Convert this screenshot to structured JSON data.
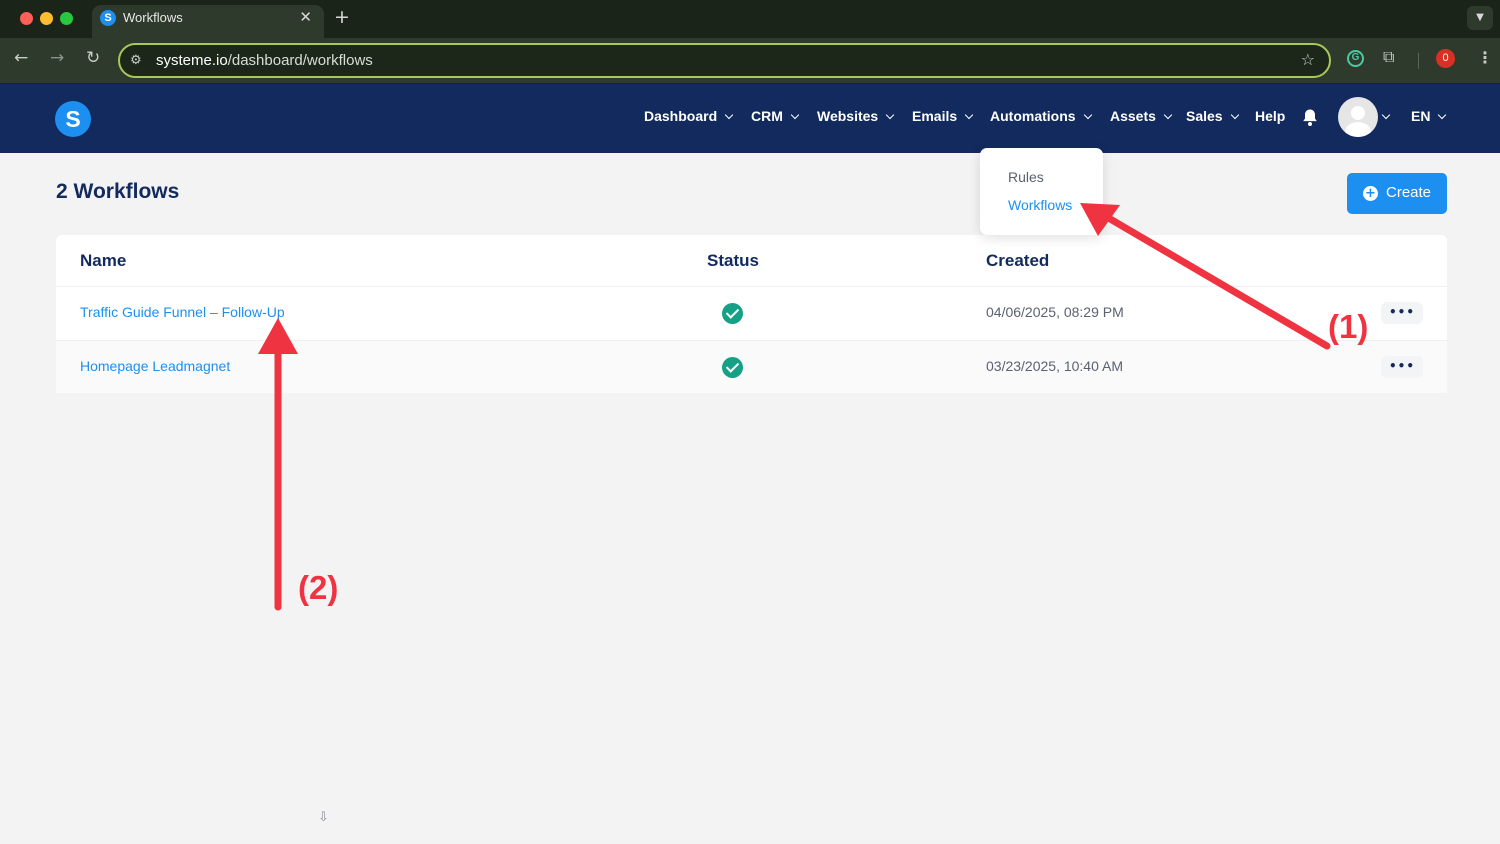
{
  "browser": {
    "tab_title": "Workflows",
    "tab_favicon": "S",
    "close_glyph": "✕",
    "new_tab_glyph": "+",
    "url_host": "systeme.io",
    "url_path": "/dashboard/workflows",
    "extension_badge": "0",
    "extension_g": "G",
    "icons": [
      "back-icon",
      "forward-icon",
      "reload-icon",
      "site-settings-icon",
      "bookmark-star-icon",
      "grammarly-icon",
      "extensions-icon",
      "menu-kebab-icon"
    ]
  },
  "header": {
    "logo_letter": "S",
    "menu": [
      {
        "label": "Dashboard"
      },
      {
        "label": "CRM"
      },
      {
        "label": "Websites"
      },
      {
        "label": "Emails"
      },
      {
        "label": "Automations"
      },
      {
        "label": "Assets"
      },
      {
        "label": "Sales"
      },
      {
        "label": "Help"
      }
    ],
    "language": "EN",
    "brand_color": "#122a5e",
    "accent_color": "#1d8ff0"
  },
  "automations_dropdown": {
    "items": [
      {
        "label": "Rules",
        "active": false
      },
      {
        "label": "Workflows",
        "active": true
      }
    ]
  },
  "page": {
    "title": "2 Workflows",
    "create_label": "Create"
  },
  "table": {
    "columns": [
      "Name",
      "Status",
      "Created"
    ],
    "rows": [
      {
        "name": "Traffic Guide Funnel – Follow-Up",
        "status": "active",
        "created": "04/06/2025, 08:29 PM",
        "menu": "•••"
      },
      {
        "name": "Homepage Leadmagnet",
        "status": "active",
        "created": "03/23/2025, 10:40 AM",
        "menu": "•••"
      }
    ],
    "status_color": "#16a085"
  },
  "annotations": {
    "label_1": "(1)",
    "label_2": "(2)",
    "color": "#ef3340"
  }
}
